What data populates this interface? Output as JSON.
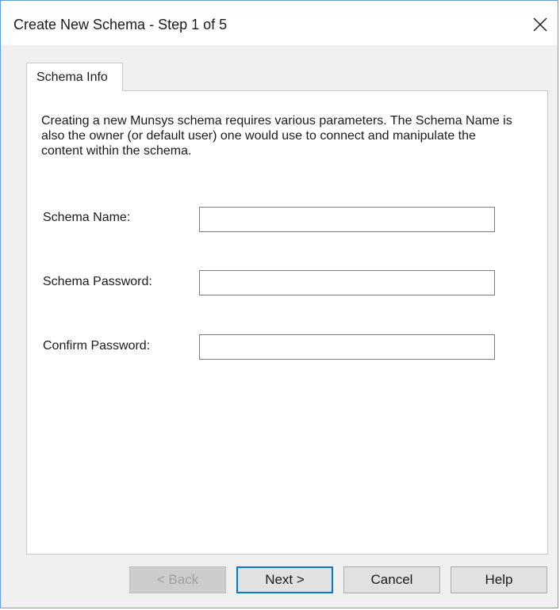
{
  "window": {
    "title": "Create New Schema - Step 1 of 5",
    "close_icon": "close-icon"
  },
  "tabs": [
    {
      "label": "Schema Info",
      "selected": true
    }
  ],
  "panel": {
    "description": "Creating a new Munsys schema requires various parameters. The Schema Name is also the owner (or default user) one would use to connect and manipulate the content within the schema.",
    "fields": {
      "schema_name": {
        "label": "Schema Name:",
        "value": ""
      },
      "schema_password": {
        "label": "Schema Password:",
        "value": ""
      },
      "confirm_password": {
        "label": "Confirm Password:",
        "value": ""
      }
    }
  },
  "buttons": {
    "back": {
      "label": "< Back",
      "enabled": false
    },
    "next": {
      "label": "Next >",
      "enabled": true,
      "default": true
    },
    "cancel": {
      "label": "Cancel",
      "enabled": true
    },
    "help": {
      "label": "Help",
      "enabled": true
    }
  },
  "colors": {
    "window_border": "#6b9bd1",
    "default_button_border": "#0078d7",
    "dialog_background": "#f0f0f0"
  }
}
